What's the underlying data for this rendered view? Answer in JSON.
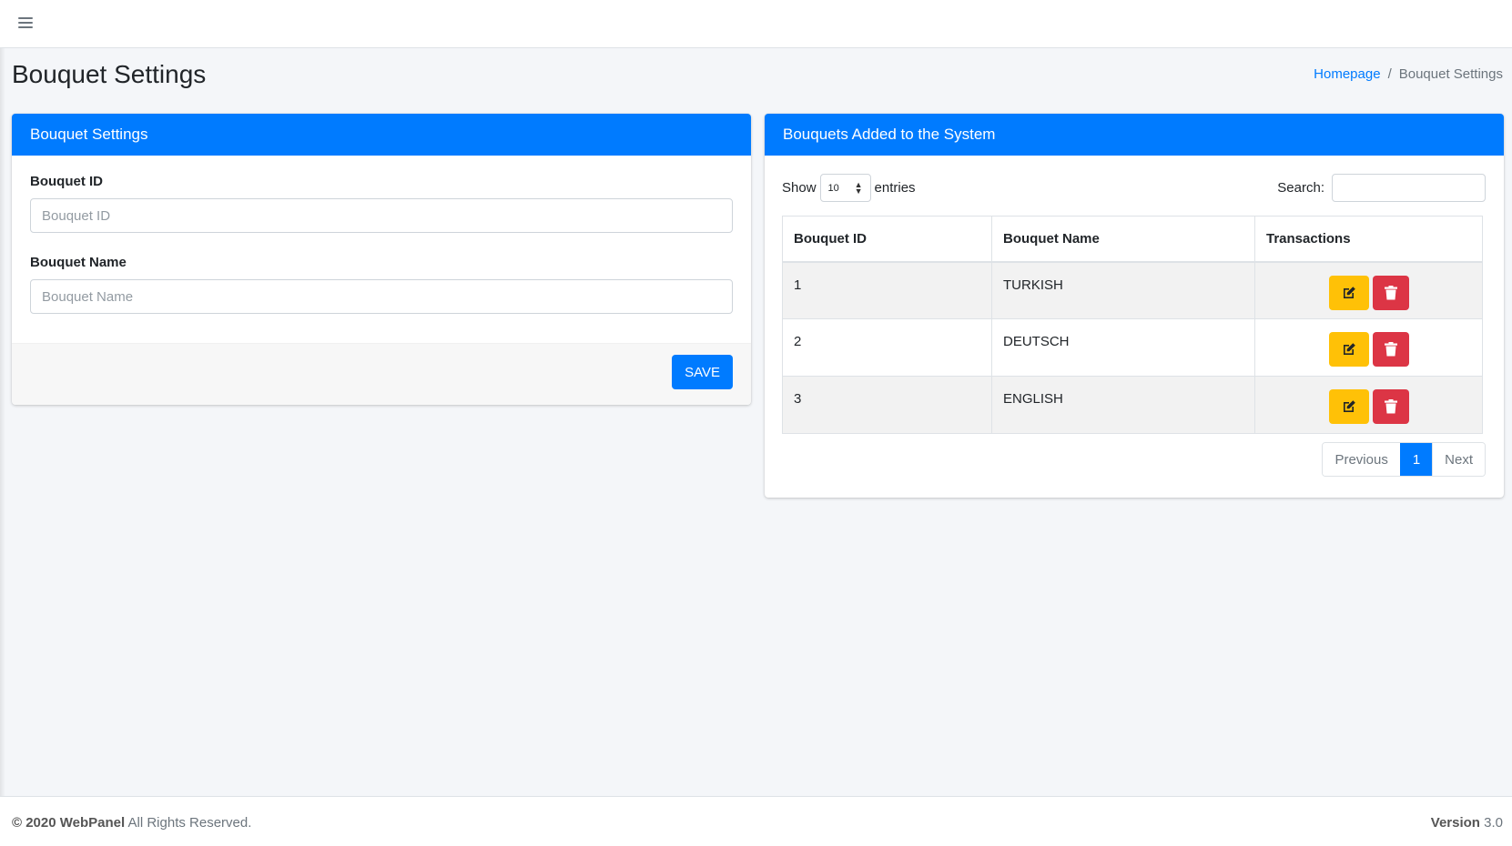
{
  "page": {
    "title": "Bouquet Settings"
  },
  "breadcrumb": {
    "home": "Homepage",
    "separator": "/",
    "current": "Bouquet Settings"
  },
  "form_card": {
    "header": "Bouquet Settings",
    "bouquet_id_label": "Bouquet ID",
    "bouquet_id_placeholder": "Bouquet ID",
    "bouquet_name_label": "Bouquet Name",
    "bouquet_name_placeholder": "Bouquet Name",
    "save_label": "SAVE"
  },
  "list_card": {
    "header": "Bouquets Added to the System",
    "show_label": "Show",
    "entries_value": "10",
    "entries_label": "entries",
    "search_label": "Search:",
    "columns": [
      "Bouquet ID",
      "Bouquet Name",
      "Transactions"
    ],
    "rows": [
      {
        "id": "1",
        "name": "TURKISH"
      },
      {
        "id": "2",
        "name": "DEUTSCH"
      },
      {
        "id": "3",
        "name": "ENGLISH"
      }
    ],
    "pagination": {
      "previous": "Previous",
      "current": "1",
      "next": "Next"
    }
  },
  "footer": {
    "copyright": "© 2020 WebPanel",
    "rights": "All Rights Reserved.",
    "version_label": "Version",
    "version_value": "3.0"
  },
  "colors": {
    "primary": "#007bff",
    "warning": "#ffc107",
    "danger": "#dc3545"
  },
  "icons": {
    "menu": "hamburger-menu-icon",
    "edit": "edit-icon",
    "delete": "trash-icon",
    "sort": "sort-arrows-icon"
  }
}
